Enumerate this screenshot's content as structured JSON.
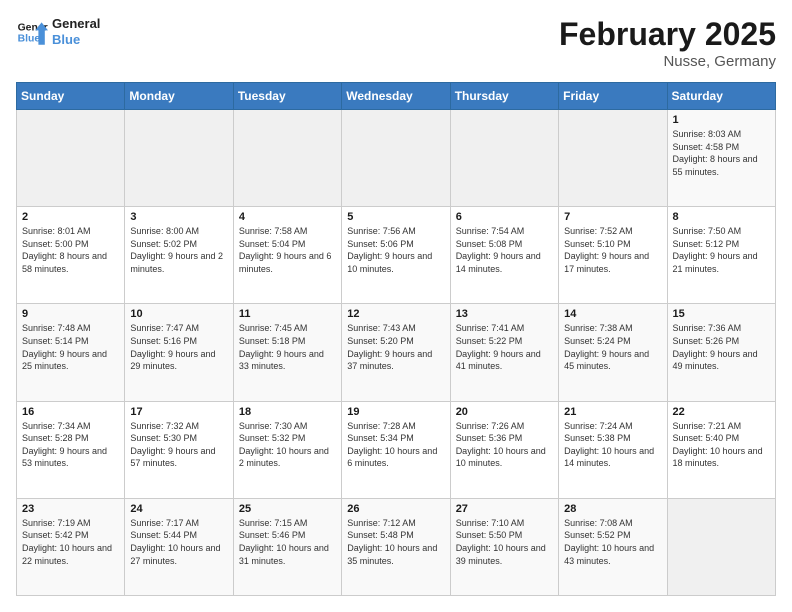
{
  "header": {
    "logo_line1": "General",
    "logo_line2": "Blue",
    "month_title": "February 2025",
    "location": "Nusse, Germany"
  },
  "days_of_week": [
    "Sunday",
    "Monday",
    "Tuesday",
    "Wednesday",
    "Thursday",
    "Friday",
    "Saturday"
  ],
  "weeks": [
    [
      {
        "num": "",
        "info": ""
      },
      {
        "num": "",
        "info": ""
      },
      {
        "num": "",
        "info": ""
      },
      {
        "num": "",
        "info": ""
      },
      {
        "num": "",
        "info": ""
      },
      {
        "num": "",
        "info": ""
      },
      {
        "num": "1",
        "info": "Sunrise: 8:03 AM\nSunset: 4:58 PM\nDaylight: 8 hours and 55 minutes."
      }
    ],
    [
      {
        "num": "2",
        "info": "Sunrise: 8:01 AM\nSunset: 5:00 PM\nDaylight: 8 hours and 58 minutes."
      },
      {
        "num": "3",
        "info": "Sunrise: 8:00 AM\nSunset: 5:02 PM\nDaylight: 9 hours and 2 minutes."
      },
      {
        "num": "4",
        "info": "Sunrise: 7:58 AM\nSunset: 5:04 PM\nDaylight: 9 hours and 6 minutes."
      },
      {
        "num": "5",
        "info": "Sunrise: 7:56 AM\nSunset: 5:06 PM\nDaylight: 9 hours and 10 minutes."
      },
      {
        "num": "6",
        "info": "Sunrise: 7:54 AM\nSunset: 5:08 PM\nDaylight: 9 hours and 14 minutes."
      },
      {
        "num": "7",
        "info": "Sunrise: 7:52 AM\nSunset: 5:10 PM\nDaylight: 9 hours and 17 minutes."
      },
      {
        "num": "8",
        "info": "Sunrise: 7:50 AM\nSunset: 5:12 PM\nDaylight: 9 hours and 21 minutes."
      }
    ],
    [
      {
        "num": "9",
        "info": "Sunrise: 7:48 AM\nSunset: 5:14 PM\nDaylight: 9 hours and 25 minutes."
      },
      {
        "num": "10",
        "info": "Sunrise: 7:47 AM\nSunset: 5:16 PM\nDaylight: 9 hours and 29 minutes."
      },
      {
        "num": "11",
        "info": "Sunrise: 7:45 AM\nSunset: 5:18 PM\nDaylight: 9 hours and 33 minutes."
      },
      {
        "num": "12",
        "info": "Sunrise: 7:43 AM\nSunset: 5:20 PM\nDaylight: 9 hours and 37 minutes."
      },
      {
        "num": "13",
        "info": "Sunrise: 7:41 AM\nSunset: 5:22 PM\nDaylight: 9 hours and 41 minutes."
      },
      {
        "num": "14",
        "info": "Sunrise: 7:38 AM\nSunset: 5:24 PM\nDaylight: 9 hours and 45 minutes."
      },
      {
        "num": "15",
        "info": "Sunrise: 7:36 AM\nSunset: 5:26 PM\nDaylight: 9 hours and 49 minutes."
      }
    ],
    [
      {
        "num": "16",
        "info": "Sunrise: 7:34 AM\nSunset: 5:28 PM\nDaylight: 9 hours and 53 minutes."
      },
      {
        "num": "17",
        "info": "Sunrise: 7:32 AM\nSunset: 5:30 PM\nDaylight: 9 hours and 57 minutes."
      },
      {
        "num": "18",
        "info": "Sunrise: 7:30 AM\nSunset: 5:32 PM\nDaylight: 10 hours and 2 minutes."
      },
      {
        "num": "19",
        "info": "Sunrise: 7:28 AM\nSunset: 5:34 PM\nDaylight: 10 hours and 6 minutes."
      },
      {
        "num": "20",
        "info": "Sunrise: 7:26 AM\nSunset: 5:36 PM\nDaylight: 10 hours and 10 minutes."
      },
      {
        "num": "21",
        "info": "Sunrise: 7:24 AM\nSunset: 5:38 PM\nDaylight: 10 hours and 14 minutes."
      },
      {
        "num": "22",
        "info": "Sunrise: 7:21 AM\nSunset: 5:40 PM\nDaylight: 10 hours and 18 minutes."
      }
    ],
    [
      {
        "num": "23",
        "info": "Sunrise: 7:19 AM\nSunset: 5:42 PM\nDaylight: 10 hours and 22 minutes."
      },
      {
        "num": "24",
        "info": "Sunrise: 7:17 AM\nSunset: 5:44 PM\nDaylight: 10 hours and 27 minutes."
      },
      {
        "num": "25",
        "info": "Sunrise: 7:15 AM\nSunset: 5:46 PM\nDaylight: 10 hours and 31 minutes."
      },
      {
        "num": "26",
        "info": "Sunrise: 7:12 AM\nSunset: 5:48 PM\nDaylight: 10 hours and 35 minutes."
      },
      {
        "num": "27",
        "info": "Sunrise: 7:10 AM\nSunset: 5:50 PM\nDaylight: 10 hours and 39 minutes."
      },
      {
        "num": "28",
        "info": "Sunrise: 7:08 AM\nSunset: 5:52 PM\nDaylight: 10 hours and 43 minutes."
      },
      {
        "num": "",
        "info": ""
      }
    ]
  ]
}
